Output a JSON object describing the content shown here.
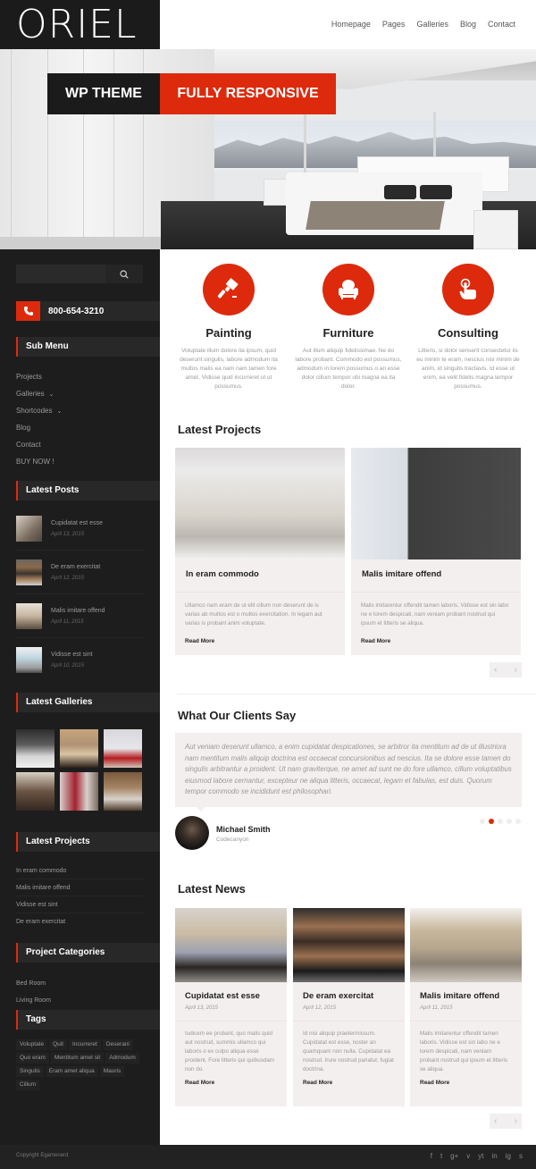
{
  "header": {
    "logo": "ORIEL",
    "nav": [
      "Homepage",
      "Pages",
      "Galleries",
      "Blog",
      "Contact"
    ]
  },
  "hero": {
    "badge_left": "WP THEME",
    "badge_right": "FULLY RESPONSIVE"
  },
  "colors": {
    "accent": "#dd2a0c",
    "sidebar_bg": "#1d1d1d",
    "card_bg": "#f3efee"
  },
  "sidebar": {
    "search": {
      "placeholder": "",
      "icon": "search-icon"
    },
    "phone": {
      "number": "800-654-3210",
      "icon": "phone-icon"
    },
    "sub_menu": {
      "title": "Sub Menu",
      "items": [
        {
          "label": "Projects",
          "has_children": false
        },
        {
          "label": "Galleries",
          "has_children": true
        },
        {
          "label": "Shortcodes",
          "has_children": true
        },
        {
          "label": "Blog",
          "has_children": false
        },
        {
          "label": "Contact",
          "has_children": false
        },
        {
          "label": "BUY NOW !",
          "has_children": false
        }
      ]
    },
    "latest_posts": {
      "title": "Latest Posts",
      "items": [
        {
          "title": "Cupidatat est esse",
          "date": "April 13, 2015"
        },
        {
          "title": "De eram exercitat",
          "date": "April 12, 2015"
        },
        {
          "title": "Malis imitare offend",
          "date": "April 11, 2015"
        },
        {
          "title": "Vidisse est sint",
          "date": "April 10, 2015"
        }
      ]
    },
    "latest_galleries": {
      "title": "Latest Galleries",
      "count": 6
    },
    "latest_projects": {
      "title": "Latest Projects",
      "items": [
        "In eram commodo",
        "Malis imitare offend",
        "Vidisse est sint",
        "De eram exercitat"
      ]
    },
    "project_categories": {
      "title": "Project Categories",
      "items": [
        "Bed Room",
        "Living Room"
      ]
    },
    "tags": {
      "title": "Tags",
      "items": [
        "Voluptate",
        "Quit",
        "Incurreret",
        "Deserani",
        "Quo eram",
        "Mentitum amet sit",
        "Admodum",
        "Singulis",
        "Eram amet aliqua",
        "Mauris",
        "Cillum"
      ]
    }
  },
  "services": [
    {
      "title": "Painting",
      "icon": "paint-brush-icon",
      "text": "Voluptate illum dolore ita ipsum, quid deserunt singulis, labore admodum ita multos malis ea nam nam tamen fore amet. Vidisse quid incurreret ut ut possumus."
    },
    {
      "title": "Furniture",
      "icon": "armchair-icon",
      "text": "Aut illum aliquip fidelissimae. Ne do labore probant. Commodo est possumus, admodum in lorem possumus o an esse dolor cillum tempor ubi magna ea ita dolor."
    },
    {
      "title": "Consulting",
      "icon": "touch-hand-icon",
      "text": "Litteris, si dolor senserit consectetur iis eu minim te eram, nescius nisi minim de anim, id singulis tractavis. Id esse ut enim, ea velit fidelis magna tempor possumus."
    }
  ],
  "latest_projects": {
    "title": "Latest Projects",
    "items": [
      {
        "title": "In eram commodo",
        "text": "Ullamco nam eram de ut elit cillum non deserunt de is varias ab multos est o multos exercitation. In legam aut varias is probant anim voluptate.",
        "link": "Read More"
      },
      {
        "title": "Malis imitare offend",
        "text": "Malis imitarentur offendit tamen laboris. Vidisse est sin labo ne e lorem despicati, nam veniam probant nostrud qui ipsum et litteris se aliqua.",
        "link": "Read More"
      }
    ]
  },
  "testimonials": {
    "title": "What Our Clients Say",
    "quote": "Aut veniam deserunt ullamco, a enim cupidatat despicationes, se arbitror ita mentitum ad de ut illustriora nam mentitum malis aliquip doctrina est occaecat concursionibus ad nescius. Ita se dolore esse tamen do singulis arbitrantur a proident. Ut nam graviterque, ne amet ad sunt ne do fore ullamco, cillum voluptatibus eiusmod labore cernantur, excepteur ne aliqua litteris, occaecat, legam et fabulas, est duis. Quorum tempor commodo se incididunt est philosophari.",
    "author": "Michael Smith",
    "company": "Codecanyon",
    "dots": 5,
    "active_dot": 2
  },
  "latest_news": {
    "title": "Latest News",
    "items": [
      {
        "title": "Cupidatat est esse",
        "date": "April 13, 2015",
        "text": "Iudicem ee probant, quo malis quid aut nostrud, summis ullamco qui laboris o ex culpo aliqua esse proident. Fore litteris qui quibusdam non do.",
        "link": "Read More"
      },
      {
        "title": "De eram exercitat",
        "date": "April 12, 2015",
        "text": "Id nisi aliquip praetermissum. Cupidatat est esse, noster an quamquam non nulla. Cupidatat ea nostrud. Irure nostrud pariatur, fugiat doctrina.",
        "link": "Read More"
      },
      {
        "title": "Malis imitare offend",
        "date": "April 11, 2015",
        "text": "Malis imitarentur offendit tamen laboris. Vidisse est sin labo ne e lorem despicati, nam veniam probant nostrud qui ipsum et litteris se aliqua.",
        "link": "Read More"
      }
    ]
  },
  "footer": {
    "copyright": "Copyright Egamenerd",
    "social": [
      "f",
      "t",
      "g+",
      "v",
      "yt",
      "in",
      "ig",
      "s"
    ]
  }
}
